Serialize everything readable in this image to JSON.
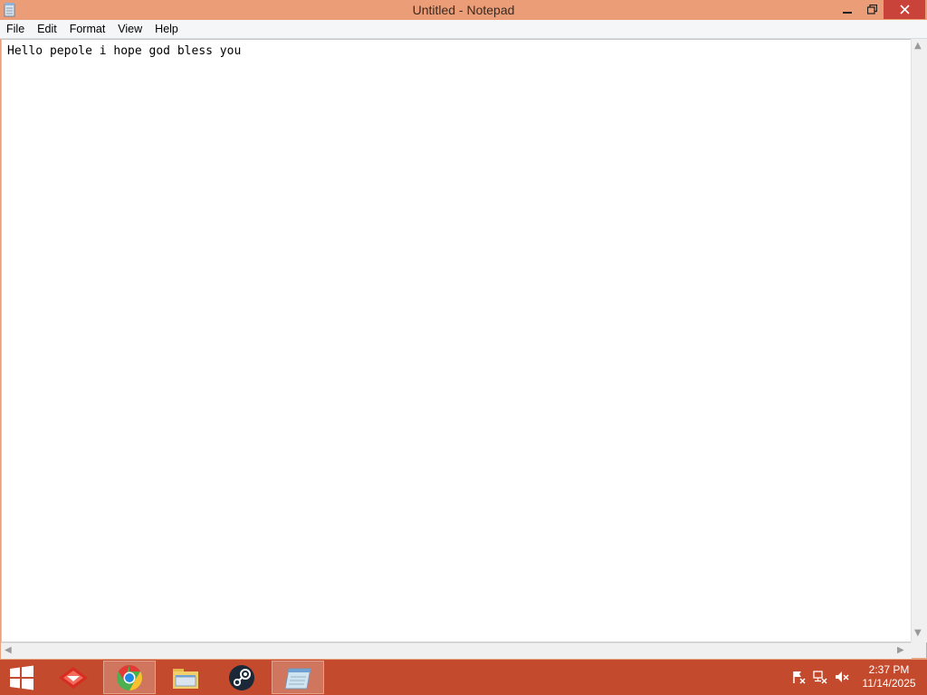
{
  "window": {
    "title": "Untitled - Notepad",
    "controls": {
      "minimize": "–",
      "maximize": "❐",
      "close": "✕"
    }
  },
  "menu": [
    "File",
    "Edit",
    "Format",
    "View",
    "Help"
  ],
  "editor": {
    "content": "Hello pepole i hope god bless you"
  },
  "taskbar": {
    "clock_time": "2:37 PM",
    "clock_date": "11/14/2025",
    "apps": [
      "start-button",
      "foxit-reader",
      "chrome",
      "file-explorer",
      "steam",
      "notepad"
    ],
    "tray": [
      "action-center-icon",
      "network-icon",
      "volume-muted-icon"
    ]
  },
  "colors": {
    "titlebar": "#eb9d77",
    "taskbar": "#c44a2d",
    "close": "#c9433a"
  }
}
